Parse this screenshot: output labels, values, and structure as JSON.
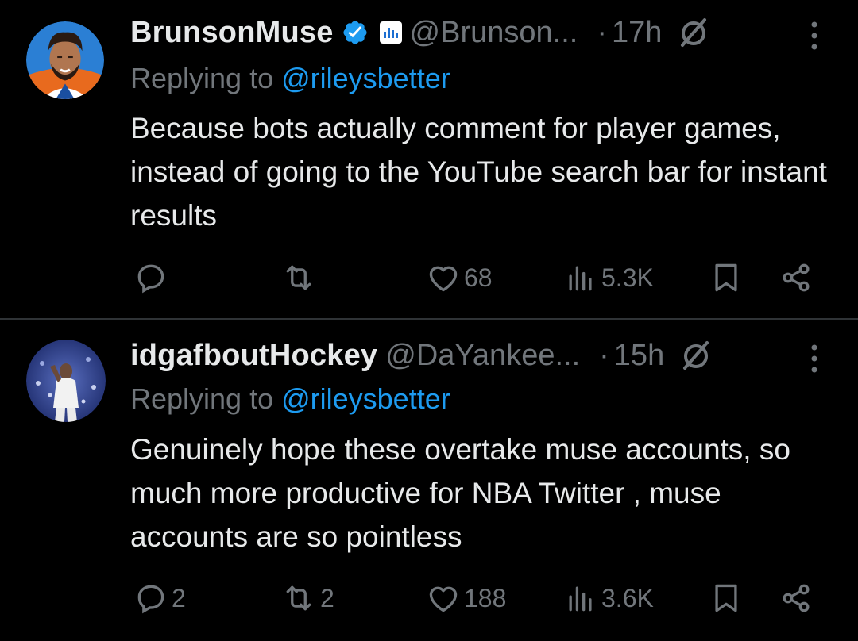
{
  "colors": {
    "background": "#000000",
    "text": "#e7e9ea",
    "secondary": "#71767b",
    "accent": "#1d9bf0",
    "divider": "#2f3336"
  },
  "tweets": [
    {
      "name": "BrunsonMuse",
      "verified": true,
      "handle": "@Brunson...",
      "separator": "·",
      "time": "17h",
      "replying_prefix": "Replying to ",
      "replying_to": "@rileysbetter",
      "text": "Because bots actually comment for player games, instead of going to the YouTube search bar for instant results",
      "replies": "",
      "reposts": "",
      "likes": "68",
      "views": "5.3K"
    },
    {
      "name": "idgafboutHockey",
      "verified": false,
      "handle": "@DaYankee...",
      "separator": "·",
      "time": "15h",
      "replying_prefix": "Replying to ",
      "replying_to": "@rileysbetter",
      "text": "Genuinely hope these overtake muse accounts, so much more productive for NBA Twitter , muse accounts are so pointless",
      "replies": "2",
      "reposts": "2",
      "likes": "188",
      "views": "3.6K"
    }
  ]
}
